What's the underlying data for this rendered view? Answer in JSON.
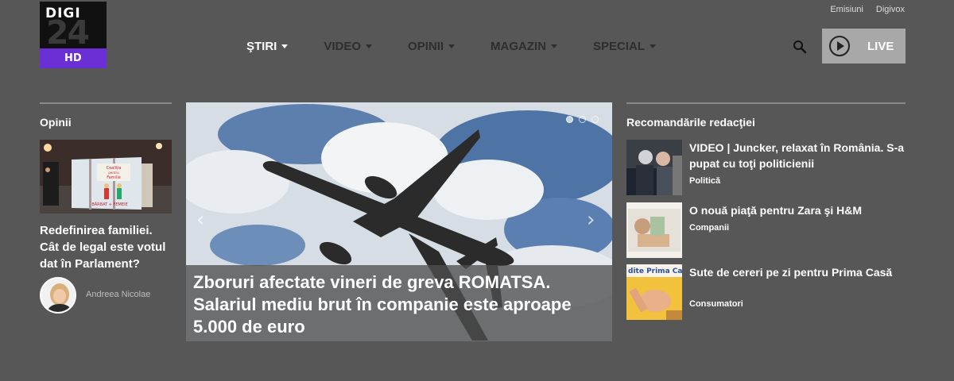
{
  "brand": {
    "line1": "DIGI",
    "line2": "24",
    "badge": "HD",
    "accent": "#6b2fd6"
  },
  "toplinks": [
    "Emisiuni",
    "Digivox"
  ],
  "nav": [
    {
      "label": "ŞTIRI",
      "active": true
    },
    {
      "label": "VIDEO",
      "active": false
    },
    {
      "label": "OPINII",
      "active": false
    },
    {
      "label": "MAGAZIN",
      "active": false
    },
    {
      "label": "SPECIAL",
      "active": false
    }
  ],
  "live": {
    "label": "LIVE",
    "icon": "play-circle-icon"
  },
  "opinii": {
    "title": "Opinii",
    "poster_text": [
      "Coaliția",
      "pentru",
      "Familie",
      "BĂRBAT + FEMEIE"
    ],
    "article_title": "Redefinirea familiei. Cât de legal este votul dat în Parlament?",
    "author": "Andreea Nicolae"
  },
  "hero": {
    "caption": "Zboruri afectate vineri de greva ROMATSA. Salariul mediu brut în companie este aproape 5.000 de euro",
    "slides": 3,
    "active_slide": 1
  },
  "recommendations": {
    "title": "Recomandările redacţiei",
    "items": [
      {
        "title": "VIDEO | Juncker, relaxat în România. S-a pupat cu toţi politicienii",
        "category": "Politică"
      },
      {
        "title": "O nouă piaţă pentru Zara şi H&M",
        "category": "Companii"
      },
      {
        "title": "Sute de cereri pe zi pentru Prima Casă",
        "category": "Consumatori",
        "thumb_text": "dite Prima Ca"
      }
    ]
  }
}
